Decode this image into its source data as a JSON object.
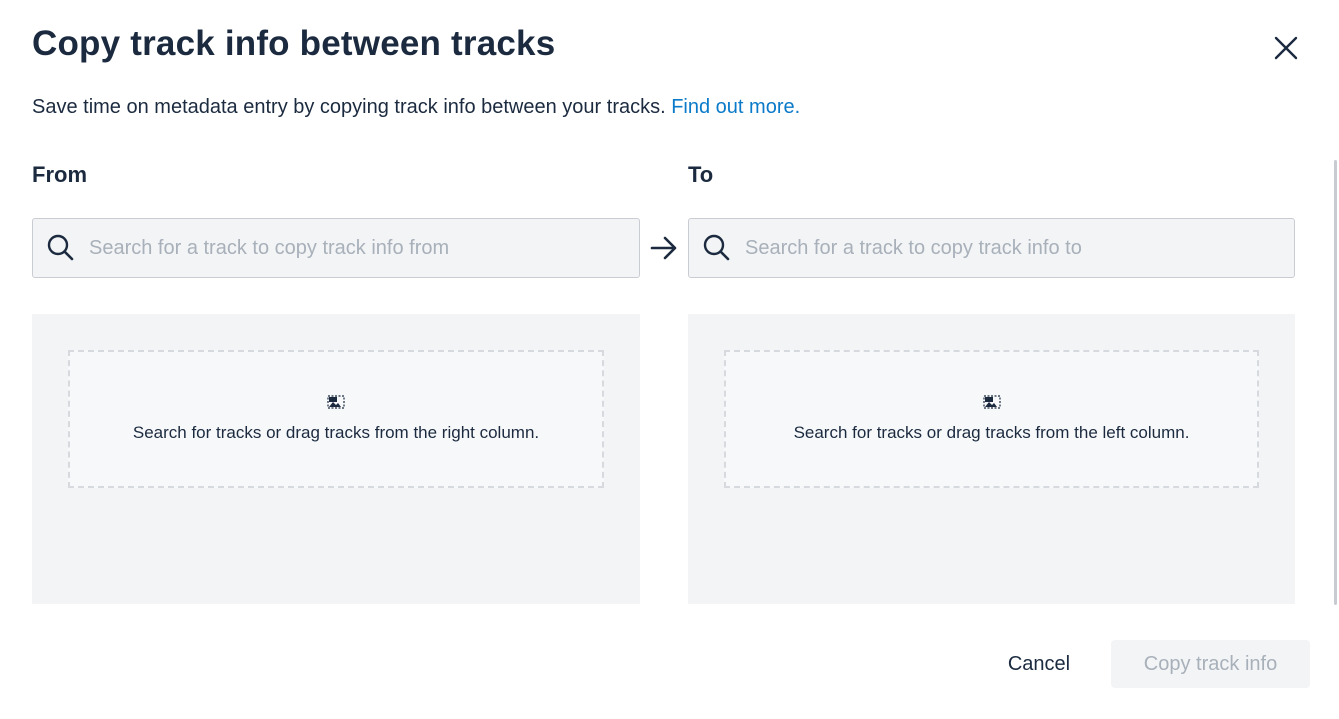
{
  "dialog": {
    "title": "Copy track info between tracks",
    "subtitle": "Save time on metadata entry by copying track info between your tracks.",
    "link_text": "Find out more."
  },
  "from": {
    "label": "From",
    "search_placeholder": "Search for a track to copy track info from",
    "search_value": "",
    "empty_message": "Search for tracks or drag tracks from the right column."
  },
  "to": {
    "label": "To",
    "search_placeholder": "Search for a track to copy track info to",
    "search_value": "",
    "empty_message": "Search for tracks or drag tracks from the left column."
  },
  "actions": {
    "cancel_label": "Cancel",
    "copy_label": "Copy track info"
  },
  "icons": {
    "close": "close-icon",
    "search": "search-icon",
    "arrow": "arrow-right-icon",
    "image": "image-icon"
  },
  "colors": {
    "text": "#1b2a3f",
    "link": "#0a7ac9",
    "placeholder": "#a8b0ba",
    "panel_bg": "#f3f4f6",
    "disabled_text": "#a8b0ba"
  }
}
